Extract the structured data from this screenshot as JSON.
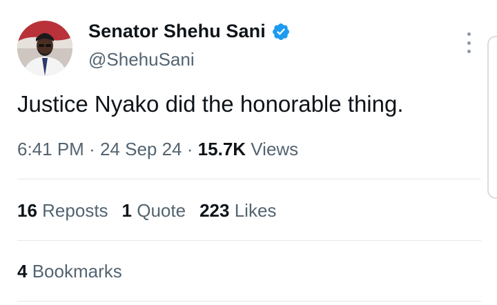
{
  "author": {
    "display_name": "Senator Shehu Sani",
    "handle": "@ShehuSani",
    "verified": true,
    "verified_color": "#1d9bf0",
    "avatar_icon": "profile-photo"
  },
  "tweet": {
    "text": "Justice Nyako did the honorable thing.",
    "time": "6:41 PM",
    "date": "24 Sep 24",
    "views_count": "15.7K",
    "views_label": "Views",
    "separator": "·"
  },
  "stats": {
    "reposts_count": "16",
    "reposts_label": "Reposts",
    "quotes_count": "1",
    "quotes_label": "Quote",
    "likes_count": "223",
    "likes_label": "Likes",
    "bookmarks_count": "4",
    "bookmarks_label": "Bookmarks"
  },
  "icons": {
    "more": "more-vertical-icon",
    "verified": "verified-badge-icon"
  }
}
